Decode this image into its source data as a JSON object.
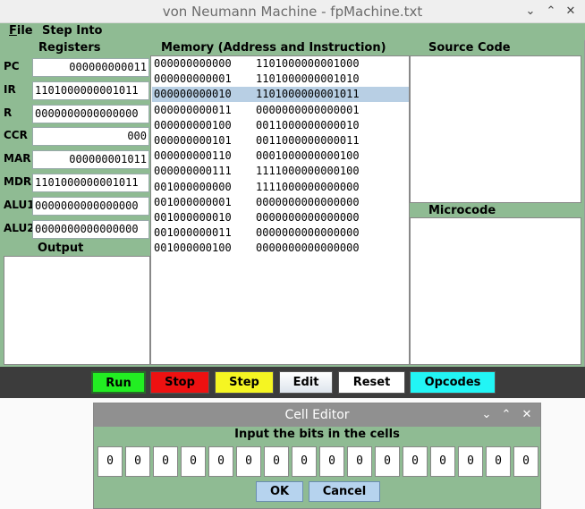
{
  "window": {
    "title": "von Neumann Machine - fpMachine.txt",
    "controls": {
      "minimize": "⌄",
      "maximize": "⌃",
      "close": "✕"
    }
  },
  "menu": {
    "file": "File",
    "step_into": "Step Into"
  },
  "registers": {
    "heading": "Registers",
    "items": [
      {
        "label": "PC",
        "value": "000000000011"
      },
      {
        "label": "IR",
        "value": "1101000000001011"
      },
      {
        "label": "R",
        "value": "0000000000000000"
      },
      {
        "label": "CCR",
        "value": "000"
      },
      {
        "label": "MAR",
        "value": "000000001011"
      },
      {
        "label": "MDR",
        "value": "1101000000001011"
      },
      {
        "label": "ALU1",
        "value": "0000000000000000"
      },
      {
        "label": "ALU2",
        "value": "0000000000000000"
      }
    ]
  },
  "output": {
    "heading": "Output"
  },
  "memory": {
    "heading": "Memory (Address and Instruction)",
    "selected_index": 2,
    "rows": [
      {
        "address": "000000000000",
        "instruction": "1101000000001000"
      },
      {
        "address": "000000000001",
        "instruction": "1101000000001010"
      },
      {
        "address": "000000000010",
        "instruction": "1101000000001011"
      },
      {
        "address": "000000000011",
        "instruction": "0000000000000001"
      },
      {
        "address": "000000000100",
        "instruction": "0011000000000010"
      },
      {
        "address": "000000000101",
        "instruction": "0011000000000011"
      },
      {
        "address": "000000000110",
        "instruction": "0001000000000100"
      },
      {
        "address": "000000000111",
        "instruction": "1111000000000100"
      },
      {
        "address": "001000000000",
        "instruction": "1111000000000000"
      },
      {
        "address": "001000000001",
        "instruction": "0000000000000000"
      },
      {
        "address": "001000000010",
        "instruction": "0000000000000000"
      },
      {
        "address": "001000000011",
        "instruction": "0000000000000000"
      },
      {
        "address": "001000000100",
        "instruction": "0000000000000000"
      }
    ]
  },
  "source_code": {
    "heading": "Source Code"
  },
  "microcode": {
    "heading": "Microcode"
  },
  "buttons": {
    "run": "Run",
    "stop": "Stop",
    "step": "Step",
    "edit": "Edit",
    "reset": "Reset",
    "opcodes": "Opcodes"
  },
  "colors": {
    "run": "#22ee22",
    "stop": "#ee1111",
    "step": "#f5f522",
    "edit": "#f0f0f0",
    "reset": "#ffffff",
    "opcodes": "#22f5f5",
    "panel": "#8fbb93",
    "selection": "#b8cfe4"
  },
  "cell_editor": {
    "title": "Cell Editor",
    "prompt": "Input the bits in the cells",
    "bits": [
      "0",
      "0",
      "0",
      "0",
      "0",
      "0",
      "0",
      "0",
      "0",
      "0",
      "0",
      "0",
      "0",
      "0",
      "0",
      "0"
    ],
    "ok": "OK",
    "cancel": "Cancel"
  }
}
